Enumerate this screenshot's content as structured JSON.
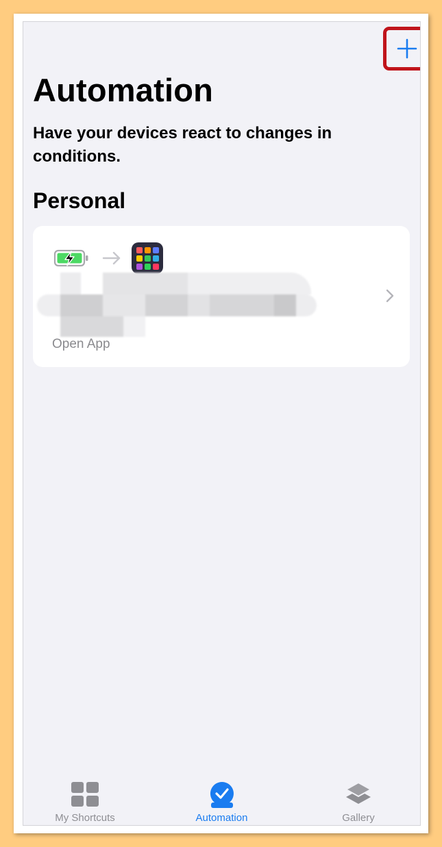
{
  "header": {
    "title": "Automation",
    "subtitle": "Have your devices react to changes in conditions.",
    "add_icon": "plus-icon"
  },
  "section": {
    "title": "Personal"
  },
  "automation_card": {
    "trigger_icon": "battery-charging-icon",
    "action_icon": "app-grid-icon",
    "action_label": "Open App"
  },
  "tabbar": {
    "tabs": [
      {
        "label": "My Shortcuts",
        "icon": "grid-icon",
        "active": false
      },
      {
        "label": "Automation",
        "icon": "checkmark-circle-icon",
        "active": true
      },
      {
        "label": "Gallery",
        "icon": "stack-layers-icon",
        "active": false
      }
    ]
  },
  "colors": {
    "accent": "#1A7CF0",
    "highlight": "#C0141B",
    "background": "#F2F2F7",
    "outer": "#FFCC80"
  }
}
